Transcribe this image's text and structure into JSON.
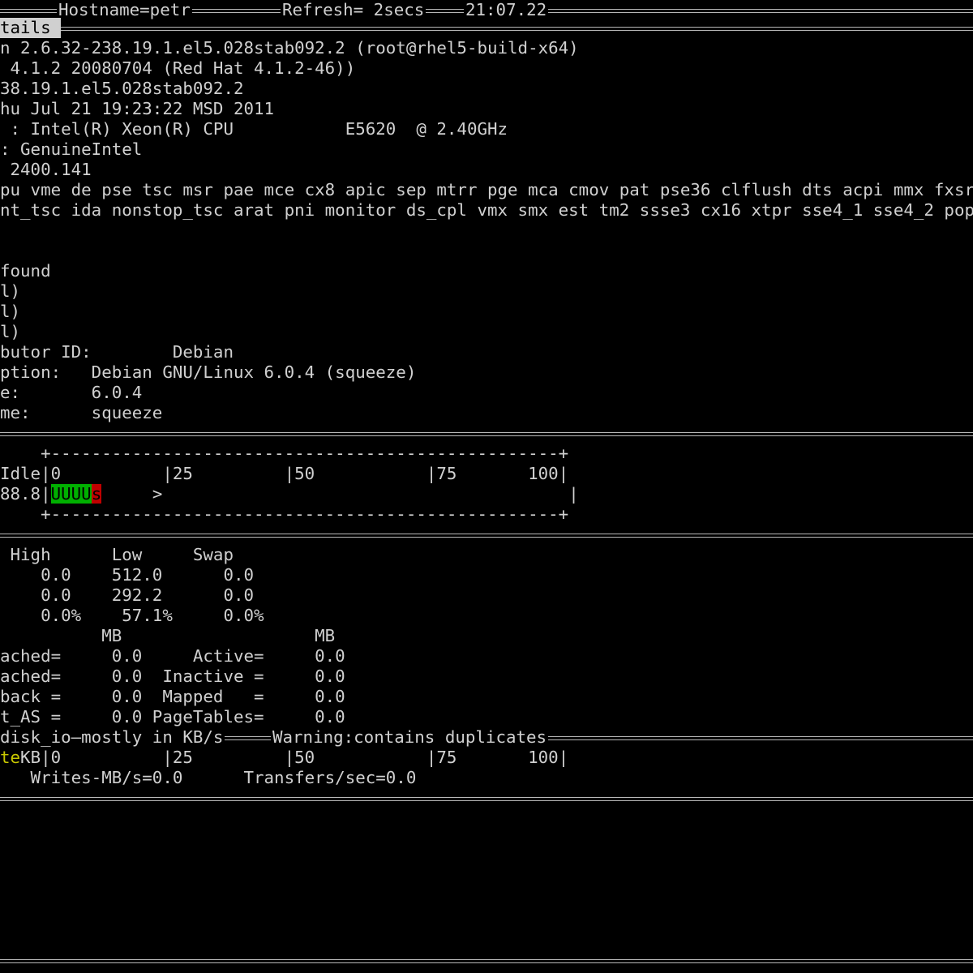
{
  "header": {
    "hostname": "Hostname=petr",
    "refresh": "Refresh= 2secs",
    "time": "21:07.22"
  },
  "kernel_section": {
    "tab_label": "tails",
    "lines": [
      "n 2.6.32-238.19.1.el5.028stab092.2 (root@rhel5-build-x64)",
      " 4.1.2 20080704 (Red Hat 4.1.2-46))",
      "38.19.1.el5.028stab092.2",
      "hu Jul 21 19:23:22 MSD 2011",
      " : Intel(R) Xeon(R) CPU           E5620  @ 2.40GHz",
      ": GenuineIntel",
      " 2400.141",
      "pu vme de pse tsc msr pae mce cx8 apic sep mtrr pge mca cmov pat pse36 clflush dts acpi mmx fxsr",
      "nt_tsc ida nonstop_tsc arat pni monitor ds_cpl vmx smx est tm2 ssse3 cx16 xtpr sse4_1 sse4_2 pop"
    ],
    "lsb_lines": [
      "found",
      "l)",
      "l)",
      "l)",
      "butor ID:        Debian",
      "ption:   Debian GNU/Linux 6.0.4 (squeeze)",
      "e:       6.0.4",
      "me:      squeeze"
    ]
  },
  "cpu_section": {
    "graph_border": "    +--------------------------------------------------+",
    "scale_label": "Idle",
    "scale": "|0          |25         |50           |75       100|",
    "idle_value": "88.8|",
    "user_bar": "UUUU",
    "sys_bar": "s",
    "graph_tail": "     >                                        |",
    "user_color": "#00b000",
    "sys_color": "#c00000"
  },
  "memory_section": {
    "header": " High      Low     Swap",
    "rows": [
      "    0.0    512.0      0.0",
      "    0.0    292.2      0.0",
      "    0.0%    57.1%     0.0%",
      "          MB                   MB",
      "ached=     0.0     Active=     0.0",
      "ached=     0.0  Inactive =     0.0",
      "back =     0.0  Mapped   =     0.0",
      "t_AS =     0.0 PageTables=     0.0"
    ]
  },
  "disk_section": {
    "title": "disk_io—mostly in KB/s",
    "warning": "Warning:contains duplicates",
    "scale_prefix": "te",
    "scale_label": "KB|0          |25         |50           |75       100|",
    "stats": "   Writes-MB/s=0.0      Transfers/sec=0.0"
  }
}
